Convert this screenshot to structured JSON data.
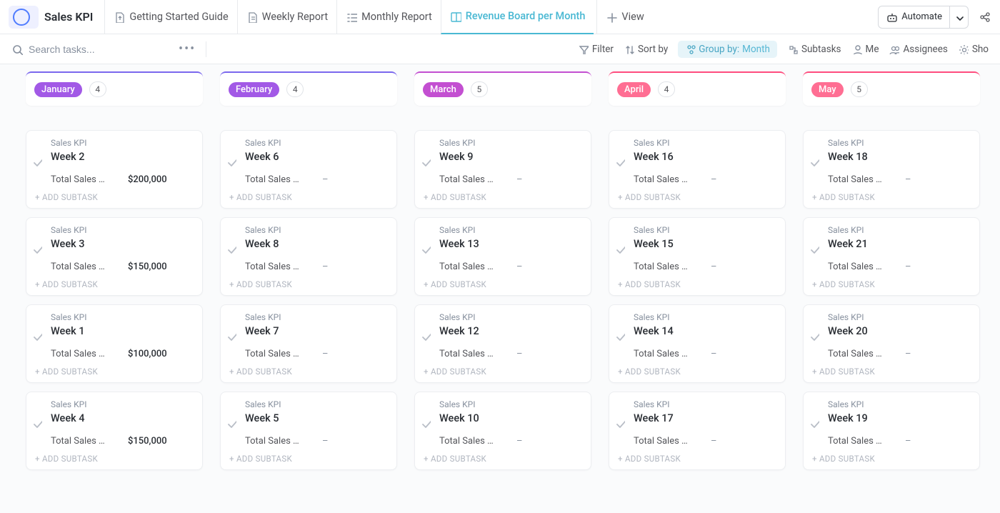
{
  "header": {
    "list_title": "Sales KPI",
    "tabs": [
      {
        "label": "Getting Started Guide",
        "icon": "doc-arrow-icon"
      },
      {
        "label": "Weekly Report",
        "icon": "doc-list-icon"
      },
      {
        "label": "Monthly Report",
        "icon": "list-icon"
      },
      {
        "label": "Revenue Board per Month",
        "icon": "board-icon",
        "active": true
      }
    ],
    "add_view_label": "View",
    "automate_label": "Automate"
  },
  "toolbar": {
    "search_placeholder": "Search tasks...",
    "filter_label": "Filter",
    "sort_label": "Sort by",
    "group_label": "Group by:",
    "group_value": "Month",
    "subtasks_label": "Subtasks",
    "me_label": "Me",
    "assignees_label": "Assignees",
    "show_label": "Sho"
  },
  "board": {
    "project_label": "Sales KPI",
    "field_label": "Total Sales …",
    "add_subtask_label": "ADD SUBTASK",
    "columns": [
      {
        "month": "January",
        "count": 4,
        "accent": "#7b68ee",
        "pill_bg": "#a259e6",
        "cards": [
          {
            "title": "Week 2",
            "value": "$200,000"
          },
          {
            "title": "Week 3",
            "value": "$150,000"
          },
          {
            "title": "Week 1",
            "value": "$100,000"
          },
          {
            "title": "Week 4",
            "value": "$150,000"
          }
        ]
      },
      {
        "month": "February",
        "count": 4,
        "accent": "#7b68ee",
        "pill_bg": "#a259e6",
        "cards": [
          {
            "title": "Week 6",
            "value": "–"
          },
          {
            "title": "Week 8",
            "value": "–"
          },
          {
            "title": "Week 7",
            "value": "–"
          },
          {
            "title": "Week 5",
            "value": "–"
          }
        ]
      },
      {
        "month": "March",
        "count": 5,
        "accent": "#c34fd1",
        "pill_bg": "#c34fd1",
        "cards": [
          {
            "title": "Week 9",
            "value": "–"
          },
          {
            "title": "Week 13",
            "value": "–"
          },
          {
            "title": "Week 12",
            "value": "–"
          },
          {
            "title": "Week 10",
            "value": "–"
          }
        ]
      },
      {
        "month": "April",
        "count": 4,
        "accent": "#ff4d7e",
        "pill_bg": "#ff6e93",
        "cards": [
          {
            "title": "Week 16",
            "value": "–"
          },
          {
            "title": "Week 15",
            "value": "–"
          },
          {
            "title": "Week 14",
            "value": "–"
          },
          {
            "title": "Week 17",
            "value": "–"
          }
        ]
      },
      {
        "month": "May",
        "count": 5,
        "accent": "#ff4d7e",
        "pill_bg": "#ff6e93",
        "cards": [
          {
            "title": "Week 18",
            "value": "–"
          },
          {
            "title": "Week 21",
            "value": "–"
          },
          {
            "title": "Week 20",
            "value": "–"
          },
          {
            "title": "Week 19",
            "value": "–"
          }
        ]
      }
    ]
  }
}
